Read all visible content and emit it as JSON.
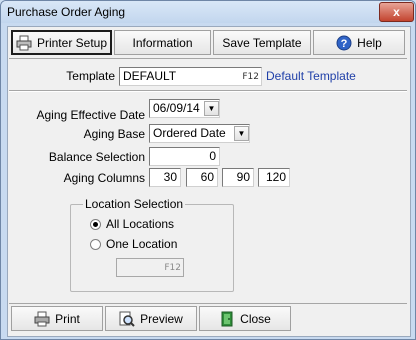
{
  "window": {
    "title": "Purchase Order Aging",
    "close_glyph": "x"
  },
  "toolbar": {
    "printer_setup": "Printer Setup",
    "information": "Information",
    "save_template": "Save Template",
    "help": "Help"
  },
  "template": {
    "label": "Template",
    "value": "DEFAULT",
    "key_hint": "F12",
    "description": "Default Template"
  },
  "form": {
    "aging_effective_date": {
      "label": "Aging Effective Date",
      "value": "06/09/14"
    },
    "aging_base": {
      "label": "Aging Base",
      "value": "Ordered Date"
    },
    "balance_selection": {
      "label": "Balance Selection",
      "value": "0"
    },
    "aging_columns": {
      "label": "Aging Columns",
      "values": [
        "30",
        "60",
        "90",
        "120"
      ]
    }
  },
  "location": {
    "group_title": "Location Selection",
    "all_label": "All Locations",
    "one_label": "One Location",
    "selected": "all",
    "key_hint": "F12"
  },
  "bottom": {
    "print": "Print",
    "preview": "Preview",
    "close": "Close"
  },
  "colors": {
    "title_bar": "#c8daf0",
    "close_button": "#c3442f",
    "template_description": "#1f3fa8"
  },
  "icons": [
    "printer-icon",
    "help-icon",
    "print-icon",
    "preview-icon",
    "close-door-icon"
  ]
}
